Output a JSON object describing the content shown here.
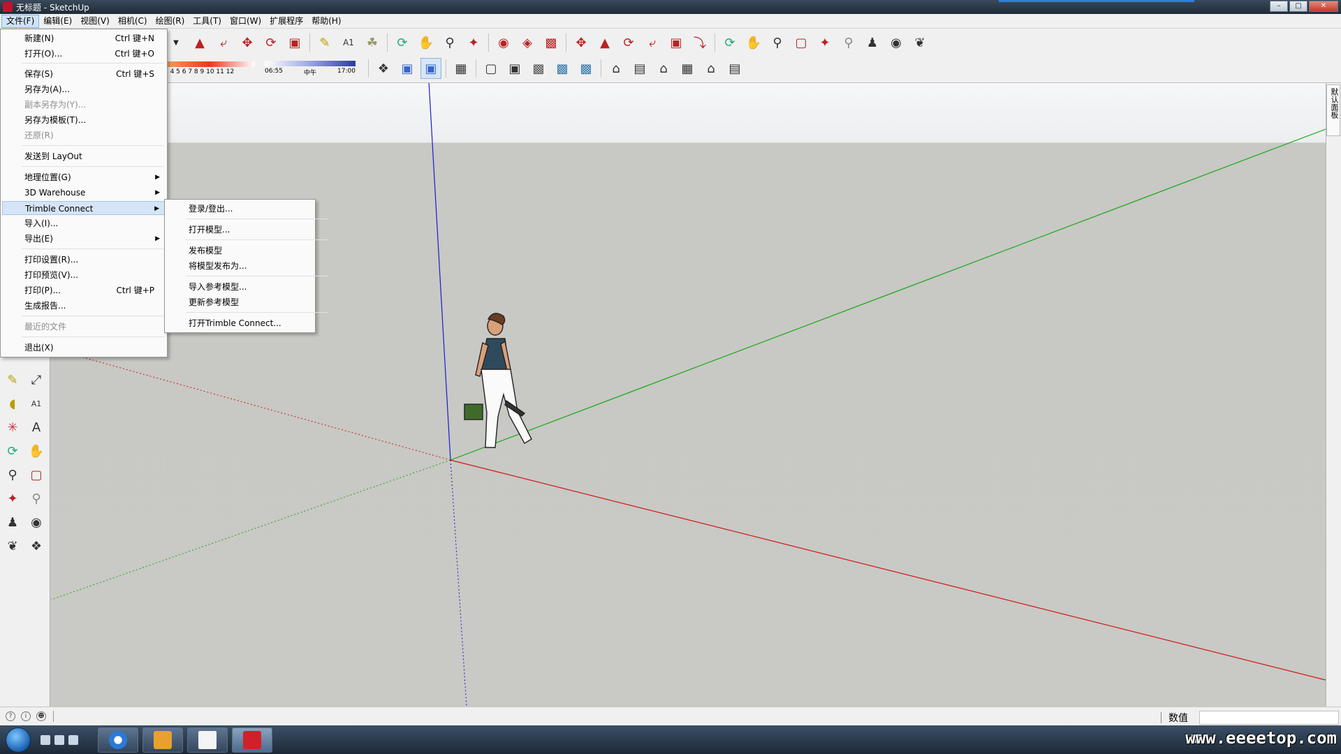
{
  "window": {
    "title": "无标题 - SketchUp",
    "controls": [
      "minimize",
      "maximize",
      "close"
    ]
  },
  "menubar": [
    "文件(F)",
    "编辑(E)",
    "视图(V)",
    "相机(C)",
    "绘图(R)",
    "工具(T)",
    "窗口(W)",
    "扩展程序",
    "帮助(H)"
  ],
  "file_menu": {
    "new": {
      "label": "新建(N)",
      "shortcut": "Ctrl 键+N"
    },
    "open": {
      "label": "打开(O)...",
      "shortcut": "Ctrl 键+O"
    },
    "save": {
      "label": "保存(S)",
      "shortcut": "Ctrl 键+S"
    },
    "save_as": {
      "label": "另存为(A)..."
    },
    "save_copy_as": {
      "label": "副本另存为(Y)..."
    },
    "save_as_template": {
      "label": "另存为模板(T)..."
    },
    "revert": {
      "label": "还原(R)"
    },
    "send_to_layout": {
      "label": "发送到 LayOut"
    },
    "geo_location": {
      "label": "地理位置(G)"
    },
    "warehouse": {
      "label": "3D Warehouse"
    },
    "trimble_connect": {
      "label": "Trimble Connect"
    },
    "import": {
      "label": "导入(I)..."
    },
    "export": {
      "label": "导出(E)"
    },
    "print_setup": {
      "label": "打印设置(R)..."
    },
    "print_preview": {
      "label": "打印预览(V)..."
    },
    "print": {
      "label": "打印(P)...",
      "shortcut": "Ctrl 键+P"
    },
    "generate_report": {
      "label": "生成报告..."
    },
    "recent_files": {
      "label": "最近的文件"
    },
    "exit": {
      "label": "退出(X)"
    }
  },
  "trimble_submenu": {
    "sign_in": "登录/登出...",
    "open_model": "打开模型...",
    "publish_model": "发布模型",
    "publish_model_as": "将模型发布为...",
    "import_reference": "导入参考模型...",
    "update_reference": "更新参考模型",
    "open_trimble_connect": "打开Trimble Connect..."
  },
  "shadow_slider": {
    "month_labels": "3  4  5  6  7  8  9  10 11 12",
    "time_start": "06:55",
    "time_mid": "中午",
    "time_end": "17:00"
  },
  "tray_panel": {
    "label": "默认面板"
  },
  "statusbar": {
    "measurements_label": "数值",
    "measurements_value": ""
  },
  "taskbar": {
    "watermark": "www.eeeetop.com"
  },
  "colors": {
    "axis_red": "#d01818",
    "axis_green": "#18a818",
    "axis_blue": "#1a1ad0",
    "sky": "#eef0f2",
    "ground": "#c9c9c5"
  }
}
